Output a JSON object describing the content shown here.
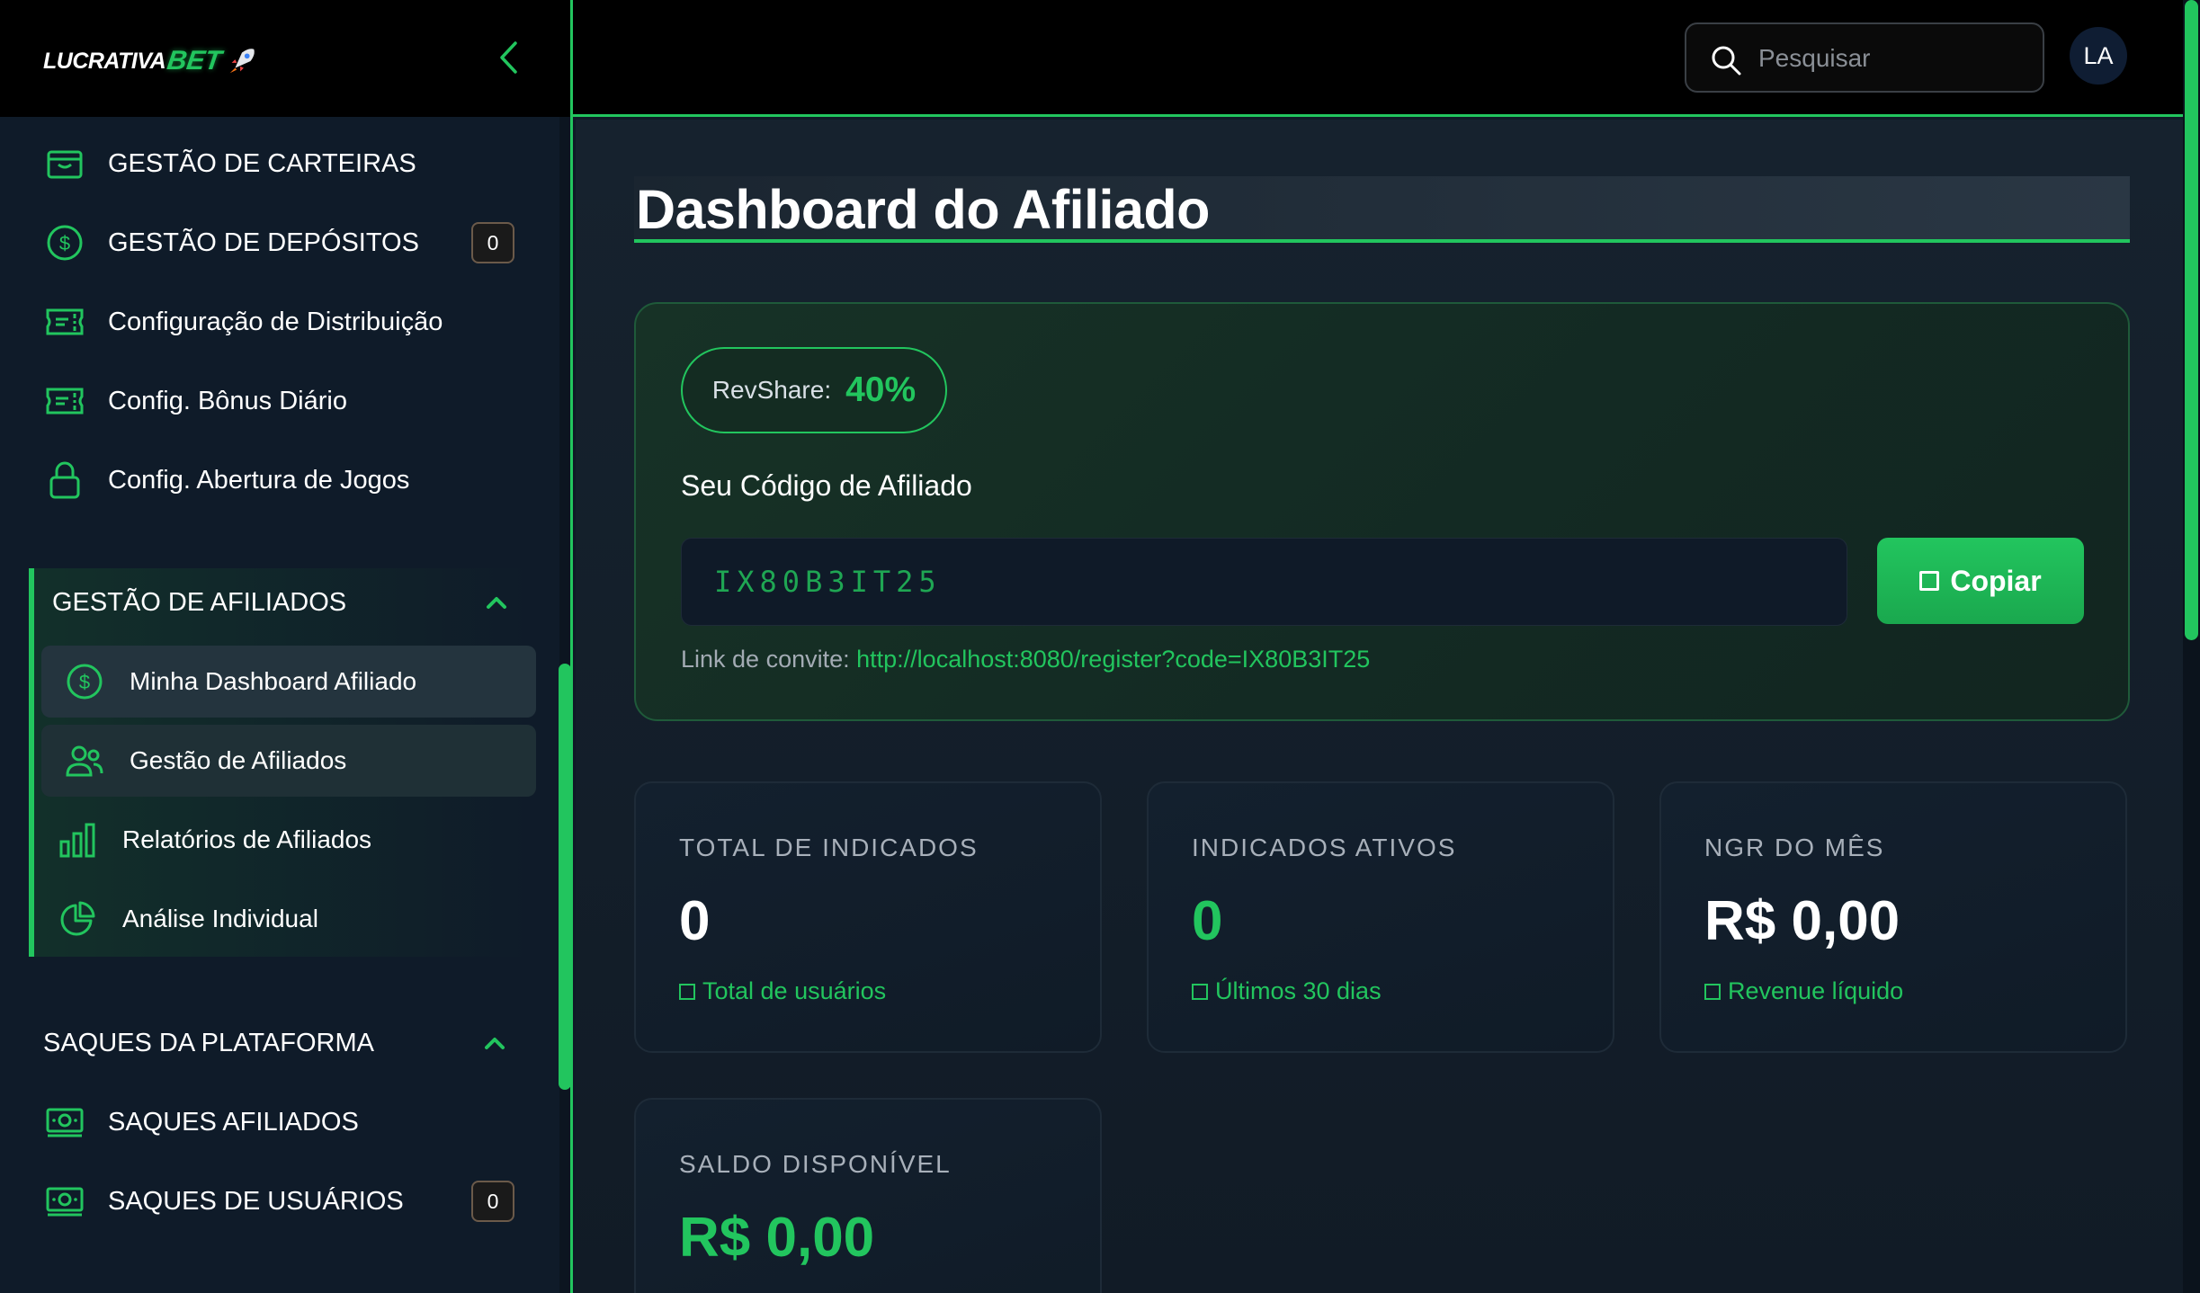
{
  "app": {
    "logo_primary": "LUCRATIVA",
    "logo_accent": "BET",
    "brand_color": "#22c55e"
  },
  "sidebar": {
    "items": [
      {
        "label": "GESTÃO DE CARTEIRAS",
        "icon": "wallet-icon"
      },
      {
        "label": "GESTÃO DE DEPÓSITOS",
        "icon": "dollar-circle-icon",
        "badge": "0"
      },
      {
        "label": "Configuração de Distribuição",
        "icon": "ticket-icon"
      },
      {
        "label": "Config. Bônus Diário",
        "icon": "ticket-icon"
      },
      {
        "label": "Config. Abertura de Jogos",
        "icon": "lock-icon"
      }
    ],
    "affiliates_group": {
      "title": "GESTÃO DE AFILIADOS",
      "items": [
        {
          "label": "Minha Dashboard Afiliado",
          "icon": "dollar-circle-icon"
        },
        {
          "label": "Gestão de Afiliados",
          "icon": "users-icon"
        },
        {
          "label": "Relatórios de Afiliados",
          "icon": "bar-chart-icon"
        },
        {
          "label": "Análise Individual",
          "icon": "pie-chart-icon"
        }
      ]
    },
    "withdrawals_section": {
      "title": "SAQUES DA PLATAFORMA",
      "items": [
        {
          "label": "SAQUES AFILIADOS",
          "icon": "cash-icon"
        },
        {
          "label": "SAQUES DE USUÁRIOS",
          "icon": "cash-icon",
          "badge": "0"
        }
      ]
    }
  },
  "header": {
    "search_placeholder": "Pesquisar",
    "avatar_initials": "LA"
  },
  "main": {
    "title": "Dashboard do Afiliado",
    "revshare_label": "RevShare:",
    "revshare_value": "40%",
    "code_label": "Seu Código de Afiliado",
    "code_value": "IX80B3IT25",
    "copy_label": "Copiar",
    "invite_label": "Link de convite:",
    "invite_url": "http://localhost:8080/register?code=IX80B3IT25",
    "stats": [
      {
        "label": "TOTAL DE INDICADOS",
        "value": "0",
        "sub": "Total de usuários"
      },
      {
        "label": "INDICADOS ATIVOS",
        "value": "0",
        "sub": "Últimos 30 dias"
      },
      {
        "label": "NGR DO MÊS",
        "value": "R$ 0,00",
        "sub": "Revenue líquido"
      },
      {
        "label": "SALDO DISPONÍVEL",
        "value": "R$ 0,00"
      }
    ]
  }
}
